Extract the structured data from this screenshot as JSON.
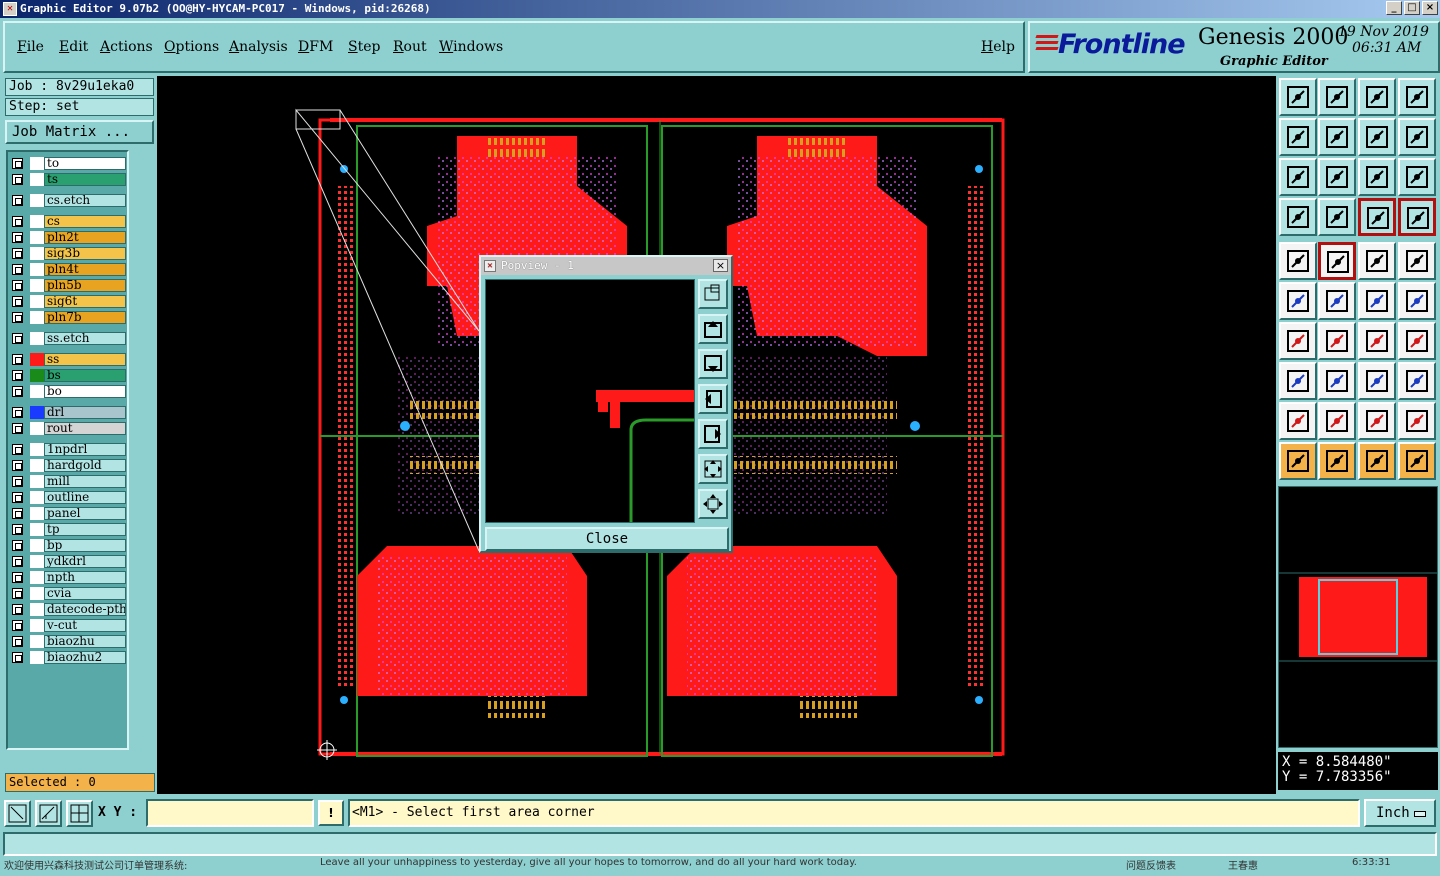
{
  "window": {
    "title": "Graphic Editor 9.07b2 (OO@HY-HYCAM-PC017 - Windows, pid:26268)",
    "buttons": [
      "_",
      "□",
      "×"
    ]
  },
  "menu": [
    "File",
    "Edit",
    "Actions",
    "Options",
    "Analysis",
    "DFM",
    "Step",
    "Rout",
    "Windows"
  ],
  "help": "Help",
  "logo": {
    "brand": "Frontline",
    "product": "Genesis 2000",
    "subtitle": "Graphic Editor",
    "date": "19 Nov 2019",
    "time": "06:31 AM"
  },
  "job": {
    "job": "Job : 8v29u1eka0",
    "step": "Step: set",
    "matrix": "Job Matrix ..."
  },
  "layers": [
    {
      "name": "to",
      "color": "#ffffff",
      "swatch": "#ffffff"
    },
    {
      "name": "ts",
      "color": "#2aa070",
      "swatch": "#ffffff"
    },
    {
      "name": "cs.etch",
      "color": "#b2e4e4",
      "swatch": "#ffffff"
    },
    {
      "name": "cs",
      "color": "#f4c44a",
      "swatch": "#ffffff"
    },
    {
      "name": "pln2t",
      "color": "#e8a420",
      "swatch": "#ffffff"
    },
    {
      "name": "sig3b",
      "color": "#f4c44a",
      "swatch": "#ffffff"
    },
    {
      "name": "pln4t",
      "color": "#e8a420",
      "swatch": "#ffffff"
    },
    {
      "name": "pln5b",
      "color": "#e8a420",
      "swatch": "#ffffff"
    },
    {
      "name": "sig6t",
      "color": "#f4c44a",
      "swatch": "#ffffff"
    },
    {
      "name": "pln7b",
      "color": "#e8a420",
      "swatch": "#ffffff"
    },
    {
      "name": "ss.etch",
      "color": "#b2e4e4",
      "swatch": "#ffffff"
    },
    {
      "name": "ss",
      "color": "#f4c44a",
      "swatch": "#ff1a1a"
    },
    {
      "name": "bs",
      "color": "#2aa070",
      "swatch": "#1a8a1a"
    },
    {
      "name": "bo",
      "color": "#ffffff",
      "swatch": "#ffffff"
    },
    {
      "name": "drl",
      "color": "#a8c4cc",
      "swatch": "#1a3aff"
    },
    {
      "name": "rout",
      "color": "#d4d4d4",
      "swatch": "#ffffff"
    },
    {
      "name": "1npdrl",
      "color": "#b2e4e4",
      "swatch": "#ffffff"
    },
    {
      "name": "hardgold",
      "color": "#b2e4e4",
      "swatch": "#ffffff"
    },
    {
      "name": "mill",
      "color": "#b2e4e4",
      "swatch": "#ffffff"
    },
    {
      "name": "outline",
      "color": "#b2e4e4",
      "swatch": "#ffffff"
    },
    {
      "name": "panel",
      "color": "#b2e4e4",
      "swatch": "#ffffff"
    },
    {
      "name": "tp",
      "color": "#b2e4e4",
      "swatch": "#ffffff"
    },
    {
      "name": "bp",
      "color": "#b2e4e4",
      "swatch": "#ffffff"
    },
    {
      "name": "ydkdrl",
      "color": "#b2e4e4",
      "swatch": "#ffffff"
    },
    {
      "name": "npth",
      "color": "#b2e4e4",
      "swatch": "#ffffff"
    },
    {
      "name": "cvia",
      "color": "#b2e4e4",
      "swatch": "#ffffff"
    },
    {
      "name": "datecode-pth",
      "color": "#b2e4e4",
      "swatch": "#ffffff"
    },
    {
      "name": "v-cut",
      "color": "#b2e4e4",
      "swatch": "#ffffff"
    },
    {
      "name": "biaozhu",
      "color": "#b2e4e4",
      "swatch": "#ffffff"
    },
    {
      "name": "biaozhu2",
      "color": "#b2e4e4",
      "swatch": "#ffffff"
    }
  ],
  "selected": "Selected : 0",
  "popview": {
    "title": "Popview - 1",
    "close": "Close"
  },
  "coords": {
    "x": "X = 8.584480\"",
    "y": "Y = 7.783356\""
  },
  "bottom": {
    "xy_label": "X Y :",
    "xy_value": "",
    "warn": "!",
    "prompt": "<M1> - Select first area corner",
    "units": "Inch"
  },
  "status": {
    "left": "欢迎使用兴森科技测试公司订单管理系统:",
    "quote": "Leave all your unhappiness to yesterday, give all your hopes to tomorrow, and do all your hard work today.",
    "mid": "问题反馈表",
    "user": "王春惠",
    "clock": "6:33:31"
  }
}
